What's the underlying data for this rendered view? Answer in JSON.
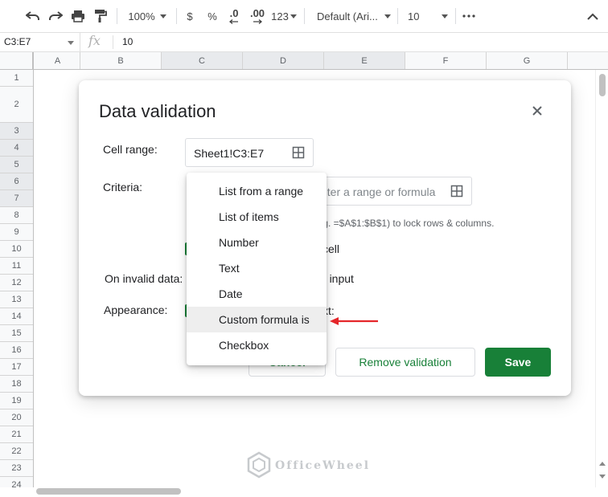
{
  "toolbar": {
    "zoom": "100%",
    "currency": "$",
    "percent": "%",
    "decrease_decimals": ".0",
    "increase_decimals": ".00",
    "more_formats": "123",
    "font": "Default (Ari...",
    "font_size": "10"
  },
  "formula_bar": {
    "name_box": "C3:E7",
    "fx": "fx",
    "value": "10"
  },
  "columns": [
    "A",
    "B",
    "C",
    "D",
    "E",
    "F",
    "G"
  ],
  "rows": [
    "1",
    "2",
    "3",
    "4",
    "5",
    "6",
    "7",
    "8",
    "9",
    "10",
    "11",
    "12",
    "13",
    "14",
    "15",
    "16",
    "17",
    "18",
    "19",
    "20",
    "21",
    "22",
    "23",
    "24"
  ],
  "dialog": {
    "title": "Data validation",
    "cell_range_label": "Cell range:",
    "cell_range_value": "Sheet1!C3:E7",
    "criteria_label": "Criteria:",
    "criteria_placeholder": "nter a range or formula",
    "hint": ".g. =$A$1:$B$1) to lock rows & columns.",
    "show_help_fragment": "cell",
    "on_invalid_label": "On invalid data:",
    "on_invalid_fragment": "ect input",
    "appearance_label": "Appearance:",
    "appearance_fragment": "xt:",
    "cancel_label": "Cancel",
    "remove_label": "Remove validation",
    "save_label": "Save"
  },
  "menu": {
    "items": [
      "List from a range",
      "List of items",
      "Number",
      "Text",
      "Date",
      "Custom formula is",
      "Checkbox"
    ],
    "highlighted": "Custom formula is"
  },
  "watermark": "OfficeWheel",
  "colors": {
    "accent": "#188038",
    "arrow": "#e5262a"
  }
}
